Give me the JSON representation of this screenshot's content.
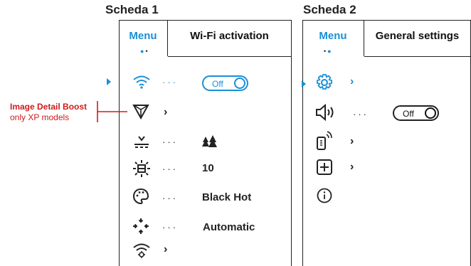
{
  "sheet1": {
    "title": "Scheda 1",
    "tabs": [
      {
        "label": "Menu",
        "active": true
      },
      {
        "label": "Wi-Fi activation",
        "active": false
      }
    ],
    "rows": [
      {
        "icon": "wifi-icon",
        "value": "Off",
        "control": "toggle"
      },
      {
        "icon": "filter-icon",
        "value": "",
        "control": "chevron"
      },
      {
        "icon": "scene-icon",
        "value": "",
        "control": "value"
      },
      {
        "icon": "brightness-icon",
        "value": "10",
        "control": "value"
      },
      {
        "icon": "palette-icon",
        "value": "Black Hot",
        "control": "value"
      },
      {
        "icon": "calibration-icon",
        "value": "Automatic",
        "control": "value"
      },
      {
        "icon": "wifi-settings-icon",
        "value": "",
        "control": "chevron"
      }
    ]
  },
  "sheet2": {
    "title": "Scheda 2",
    "tabs": [
      {
        "label": "Menu",
        "active": true
      },
      {
        "label": "General settings",
        "active": false
      }
    ],
    "rows": [
      {
        "icon": "gear-icon",
        "value": "",
        "control": "chevron"
      },
      {
        "icon": "speaker-icon",
        "value": "Off",
        "control": "toggle"
      },
      {
        "icon": "remote-icon",
        "value": "",
        "control": "chevron"
      },
      {
        "icon": "plus-box-icon",
        "value": "",
        "control": "chevron"
      },
      {
        "icon": "info-icon",
        "value": "",
        "control": "none"
      }
    ]
  },
  "callout": {
    "title": "Image Detail Boost",
    "subtitle": "only XP models",
    "color": "#d11b1b"
  },
  "colors": {
    "accent": "#1a8fd6",
    "text": "#222222"
  }
}
